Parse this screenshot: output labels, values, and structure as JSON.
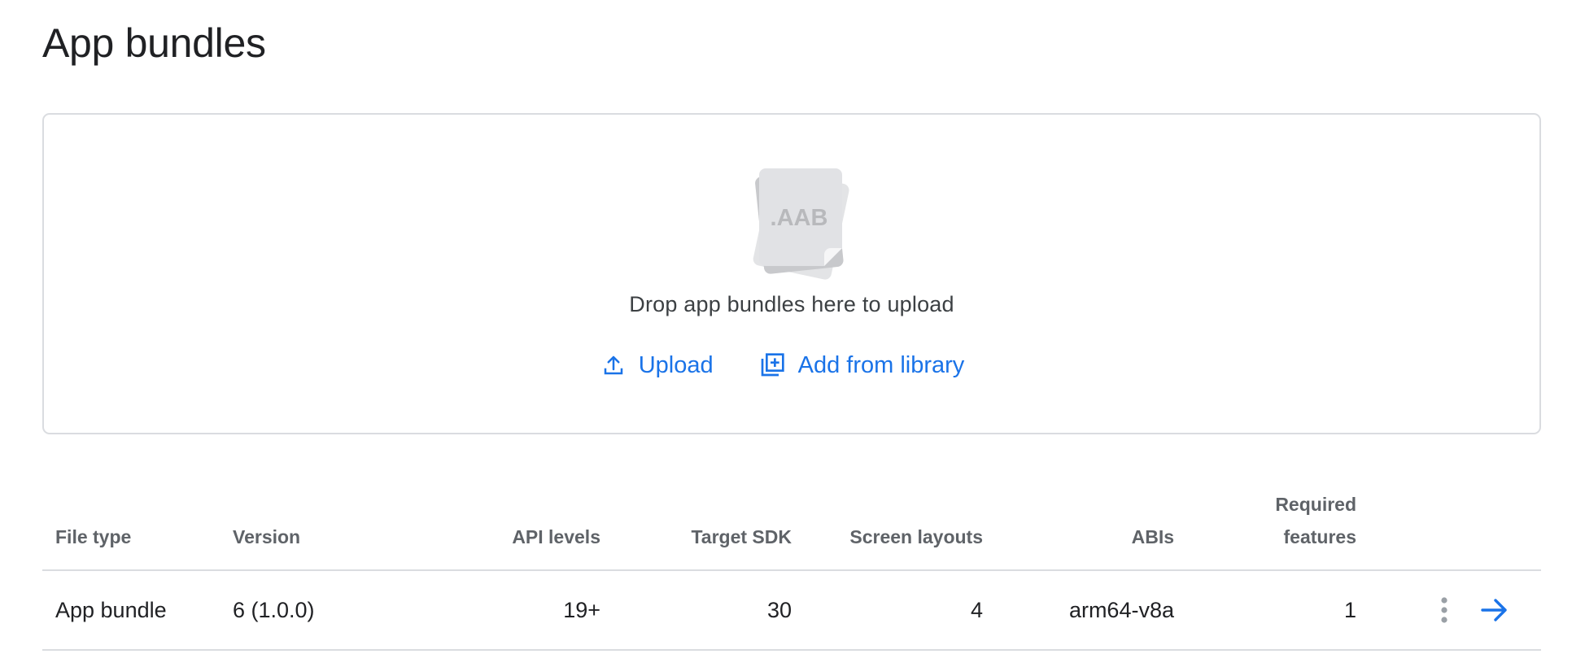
{
  "page": {
    "title": "App bundles"
  },
  "dropzone": {
    "file_badge": ".AAB",
    "drop_text": "Drop app bundles here to upload",
    "upload_label": "Upload",
    "upload_icon": "upload-icon",
    "library_label": "Add from library",
    "library_icon": "library-add-icon"
  },
  "table": {
    "headers": {
      "file_type": "File type",
      "version": "Version",
      "api_levels": "API levels",
      "target_sdk": "Target SDK",
      "screen_layouts": "Screen layouts",
      "abis": "ABIs",
      "required_line1": "Required",
      "required_line2": "features"
    },
    "rows": [
      {
        "file_type": "App bundle",
        "version": "6 (1.0.0)",
        "api_levels": "19+",
        "target_sdk": "30",
        "screen_layouts": "4",
        "abis": "arm64-v8a",
        "required_features": "1",
        "more_icon": "more-vert-icon",
        "open_icon": "arrow-forward-icon"
      }
    ]
  },
  "colors": {
    "accent": "#1a73e8",
    "border": "#dadce0",
    "header_text": "#5f6368",
    "body_text": "#202124"
  }
}
